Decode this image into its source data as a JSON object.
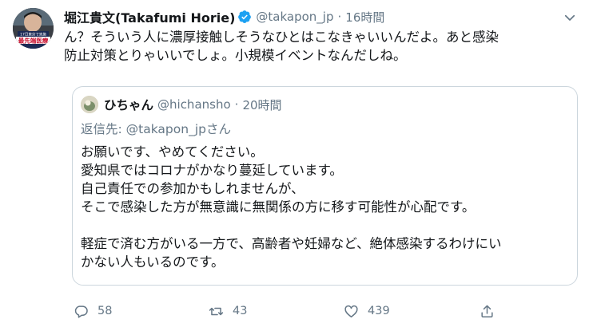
{
  "tweet": {
    "author": {
      "display_name": "堀江貴文(Takafumi Horie)",
      "handle": "@takapon_jp",
      "separator": "·",
      "time": "16時間"
    },
    "text_lines": [
      "ん？そういう人に濃厚接触しそうなひとはこなきゃいいんだよ。あと感染",
      "防止対策とりゃいいでしょ。小規模イベントなんだしね。"
    ],
    "quoted": {
      "display_name": "ひちゃん",
      "handle": "@hichansho",
      "separator": "·",
      "time": "20時間",
      "reply_prefix": "返信先: ",
      "reply_to": "@takapon_jp",
      "reply_suffix": "さん",
      "body_lines": [
        "お願いです、やめてください。",
        "愛知県ではコロナがかなり蔓延しています。",
        "自己責任での参加かもしれませんが、",
        "そこで感染した方が無意識に無関係の方に移す可能性が心配です。",
        "",
        "軽症で済む方がいる一方で、高齢者や妊婦など、絶体感染するわけにい",
        "かない人もいるのです。"
      ]
    },
    "actions": {
      "reply_count": "58",
      "retweet_count": "43",
      "like_count": "439"
    }
  },
  "avatar_caption": "最先端医療",
  "avatar_small_text": "17日東京で実施"
}
